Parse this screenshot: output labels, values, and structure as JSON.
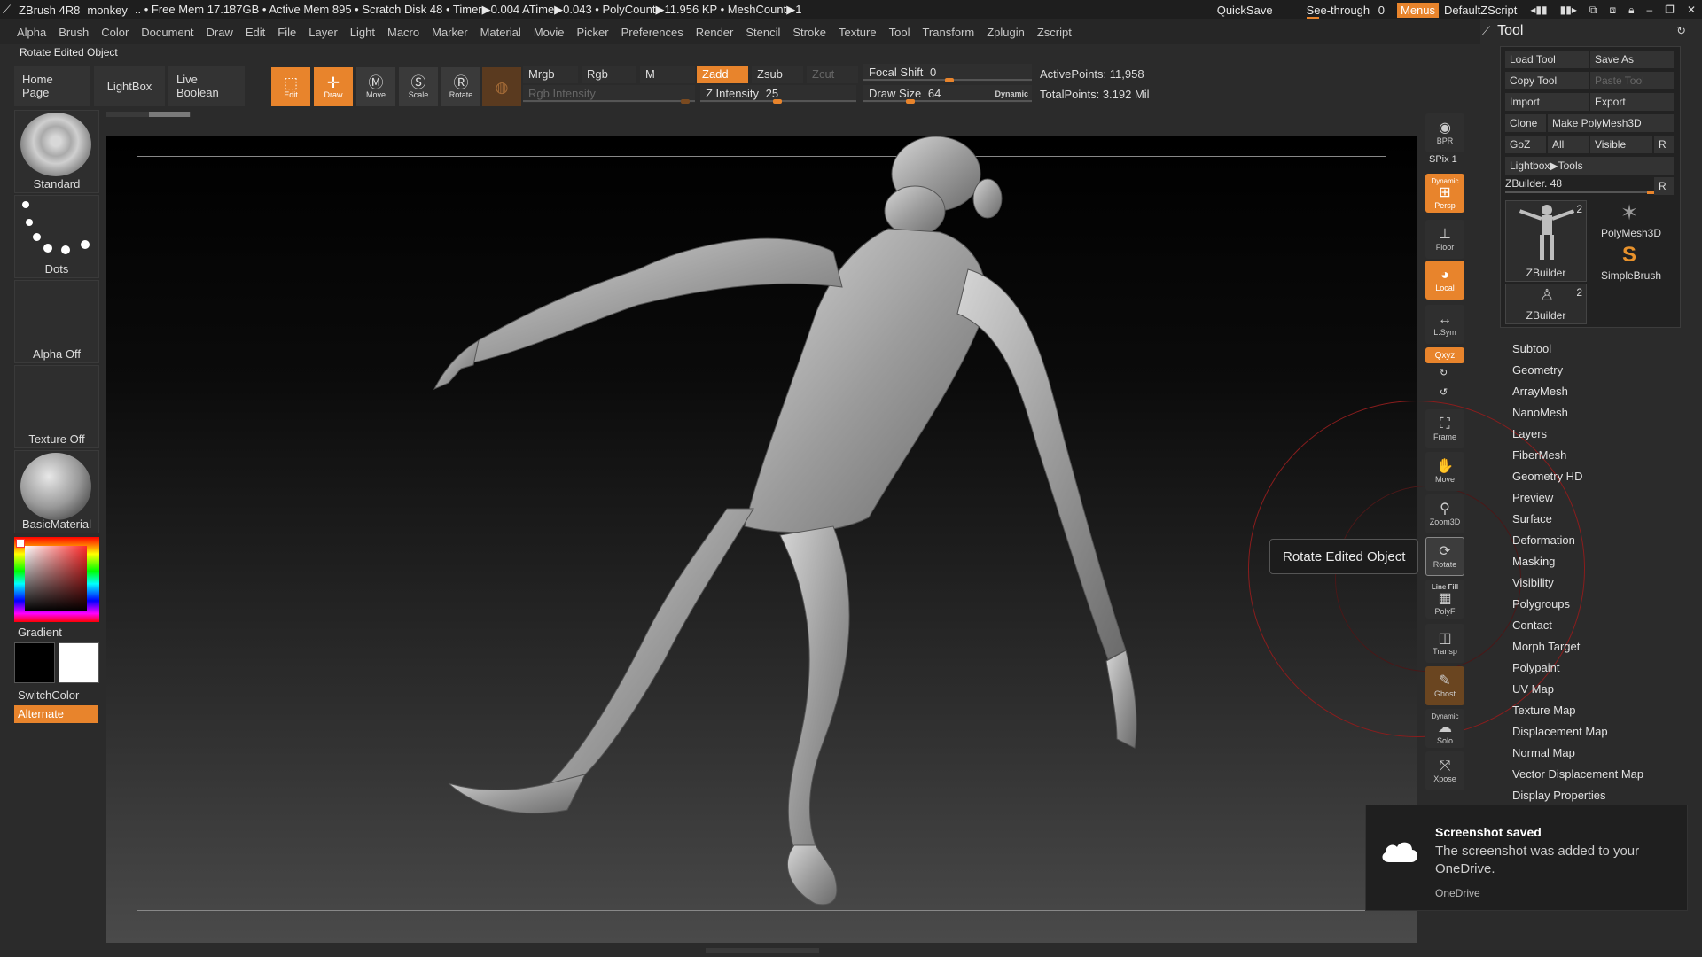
{
  "titlebar": {
    "app": "ZBrush 4R8",
    "project": "monkey",
    "stats": "..  • Free Mem 17.187GB • Active Mem 895 • Scratch Disk 48 •  Timer▶0.004 ATime▶0.043 • PolyCount▶11.956 KP  • MeshCount▶1",
    "quicksave": "QuickSave",
    "see_through": "See-through",
    "see_through_value": "0",
    "menus": "Menus",
    "script": "DefaultZScript"
  },
  "menubar": [
    "Alpha",
    "Brush",
    "Color",
    "Document",
    "Draw",
    "Edit",
    "File",
    "Layer",
    "Light",
    "Macro",
    "Marker",
    "Material",
    "Movie",
    "Picker",
    "Preferences",
    "Render",
    "Stencil",
    "Stroke",
    "Texture",
    "Tool",
    "Transform",
    "Zplugin",
    "Zscript"
  ],
  "status_text": "Rotate Edited Object",
  "shelf": {
    "home": "Home Page",
    "lightbox": "LightBox",
    "live_boolean": "Live Boolean",
    "edit": "Edit",
    "draw": "Draw",
    "move": "Move",
    "scale": "Scale",
    "rotate": "Rotate",
    "mrgb": "Mrgb",
    "rgb": "Rgb",
    "m": "M",
    "zadd": "Zadd",
    "zsub": "Zsub",
    "zcut": "Zcut",
    "rgb_intensity": "Rgb Intensity",
    "z_intensity_label": "Z Intensity",
    "z_intensity": "25",
    "focal_shift_label": "Focal Shift",
    "focal_shift": "0",
    "draw_size_label": "Draw Size",
    "draw_size": "64",
    "dynamic": "Dynamic",
    "active_points": "ActivePoints: 11,958",
    "total_points": "TotalPoints: 3.192 Mil"
  },
  "left": {
    "brush": "Standard",
    "stroke": "Dots",
    "alpha": "Alpha Off",
    "texture": "Texture Off",
    "material": "BasicMaterial",
    "gradient": "Gradient",
    "switch_color": "SwitchColor",
    "alternate": "Alternate"
  },
  "right_toolbar": {
    "bpr": "BPR",
    "spix": "SPix 1",
    "dynamic": "Dynamic",
    "persp": "Persp",
    "floor": "Floor",
    "local": "Local",
    "lsym": "L.Sym",
    "xyz": "Qxyz",
    "frame": "Frame",
    "move": "Move",
    "zoom3d": "Zoom3D",
    "rotate": "Rotate",
    "line_fill": "Line Fill",
    "polyf": "PolyF",
    "transp": "Transp",
    "ghost": "Ghost",
    "dynamic2": "Dynamic",
    "solo": "Solo",
    "xpose": "Xpose"
  },
  "tooltip": "Rotate Edited Object",
  "tool_palette": {
    "title": "Tool",
    "load_tool": "Load Tool",
    "save_as": "Save As",
    "copy_tool": "Copy Tool",
    "paste_tool": "Paste Tool",
    "import": "Import",
    "export": "Export",
    "clone": "Clone",
    "make_polymesh": "Make PolyMesh3D",
    "goz": "GoZ",
    "all": "All",
    "visible": "Visible",
    "r": "R",
    "lightbox_tools": "Lightbox▶Tools",
    "zbuilder_label": "ZBuilder. 48",
    "thumb1_label": "ZBuilder",
    "thumb1_count": "2",
    "thumb2_label": "PolyMesh3D",
    "thumb3_label": "SimpleBrush",
    "thumb4_label": "ZBuilder",
    "thumb4_count": "2",
    "subpalettes": [
      "Subtool",
      "Geometry",
      "ArrayMesh",
      "NanoMesh",
      "Layers",
      "FiberMesh",
      "Geometry HD",
      "Preview",
      "Surface",
      "Deformation",
      "Masking",
      "Visibility",
      "Polygroups",
      "Contact",
      "Morph Target",
      "Polypaint",
      "UV Map",
      "Texture Map",
      "Displacement Map",
      "Normal Map",
      "Vector Displacement Map",
      "Display Properties"
    ]
  },
  "toast": {
    "title": "Screenshot saved",
    "body": "The screenshot was added to your OneDrive.",
    "source": "OneDrive"
  },
  "colors": {
    "accent": "#e8842c",
    "panel": "#2b2b2b",
    "gizmo": "#8a1d1d"
  }
}
